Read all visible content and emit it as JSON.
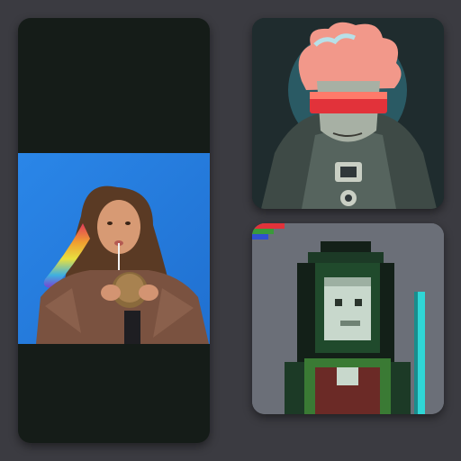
{
  "gallery": {
    "cards": [
      {
        "name": "photo-card",
        "subject": "woman-drinking-coconut-photo"
      },
      {
        "name": "illustration-card",
        "subject": "red-visor-character-illustration"
      },
      {
        "name": "pixel-art-card",
        "subject": "hooded-pixel-character"
      }
    ]
  },
  "colors": {
    "background": "#3b3b41",
    "card_dark": "#151c18",
    "photo_blue": "#2a7de0",
    "illustration_bg": "#1c2a2c",
    "pixel_bg": "#6b6f78",
    "accent_cyan": "#2fd6d6",
    "accent_red": "#e2323a"
  }
}
